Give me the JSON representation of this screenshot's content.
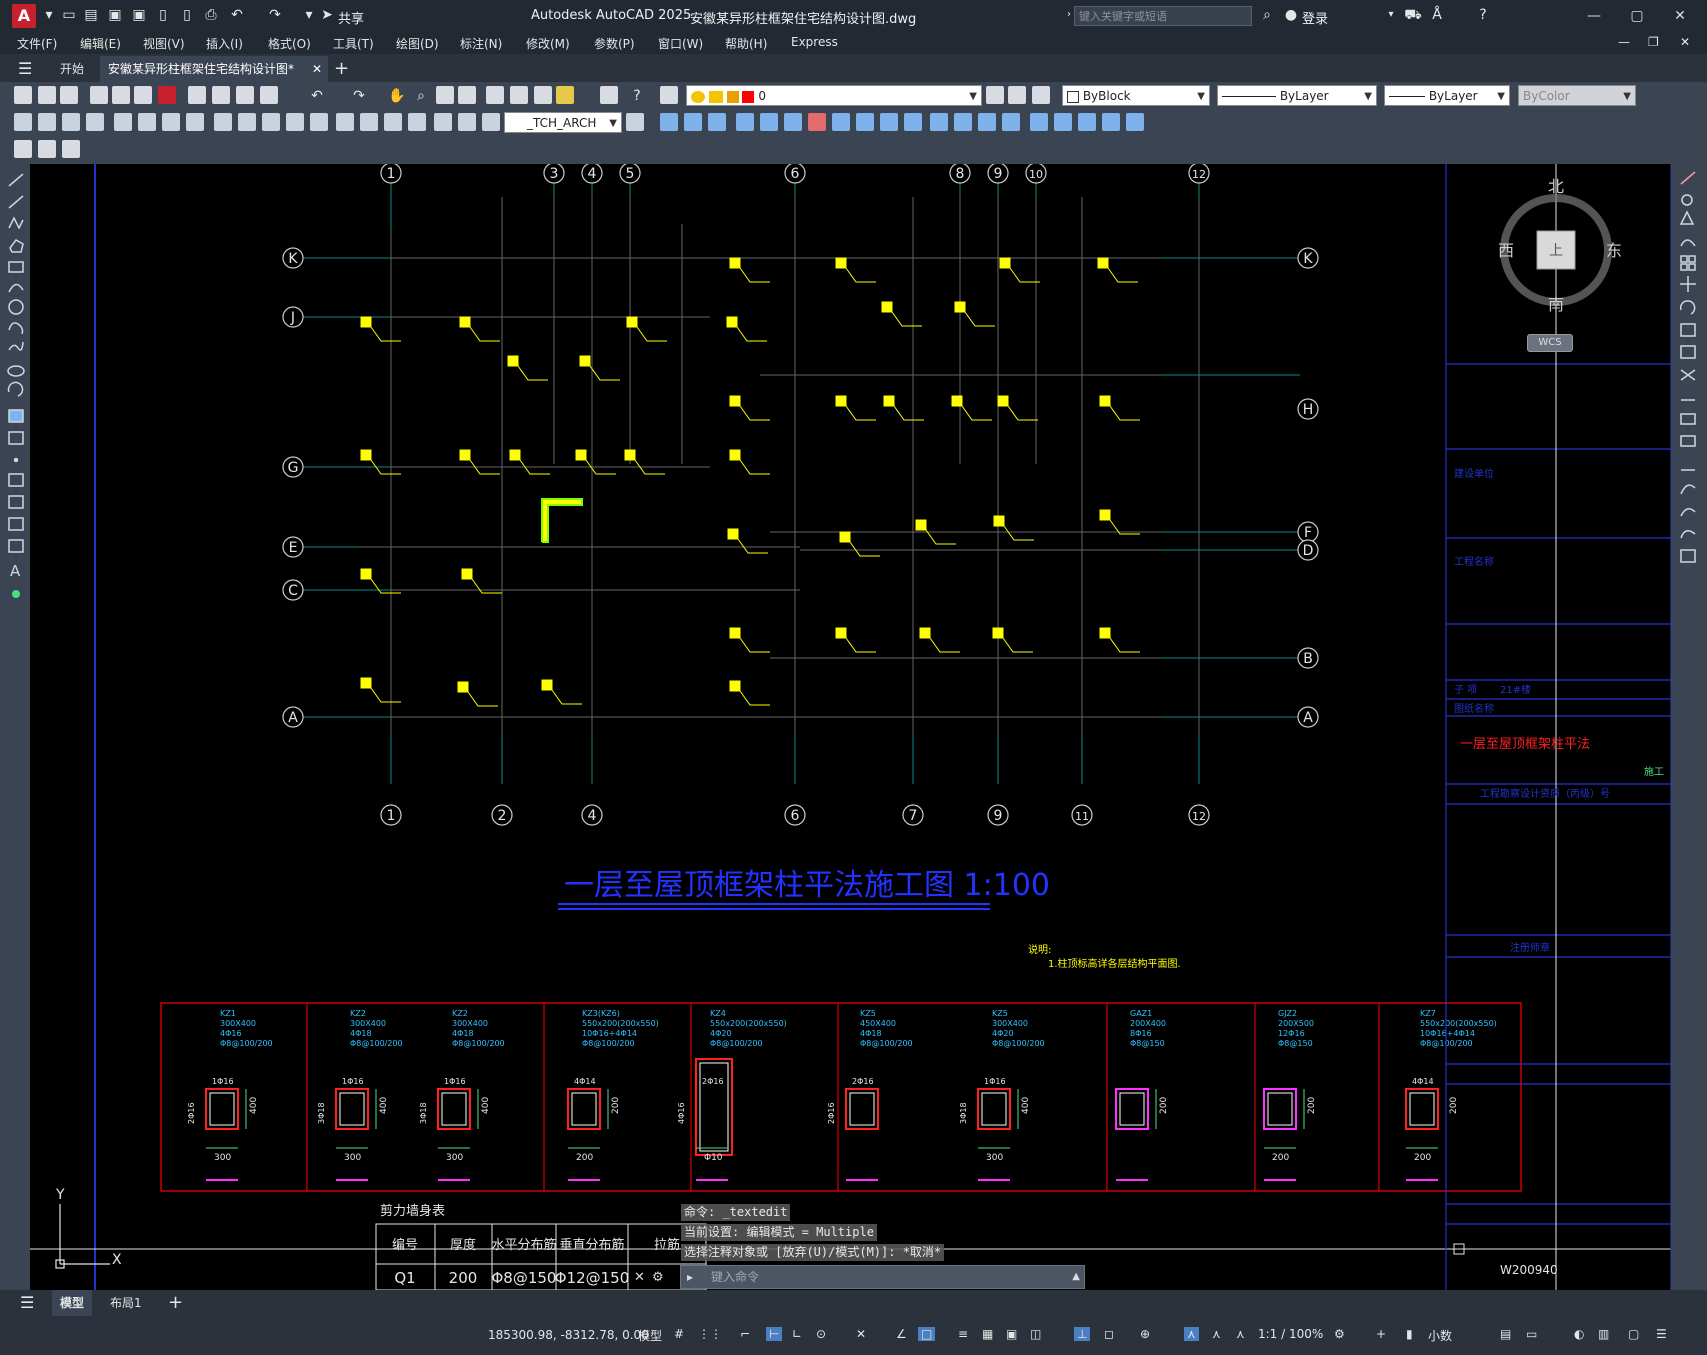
{
  "window": {
    "title": "Autodesk AutoCAD 2025",
    "filename": "安徽某异形柱框架住宅结构设计图.dwg",
    "share_label": "共享",
    "search_placeholder": "键入关键字或短语",
    "login_label": "登录"
  },
  "menu": [
    "文件(F)",
    "编辑(E)",
    "视图(V)",
    "插入(I)",
    "格式(O)",
    "工具(T)",
    "绘图(D)",
    "标注(N)",
    "修改(M)",
    "参数(P)",
    "窗口(W)",
    "帮助(H)",
    "Express"
  ],
  "tabs": {
    "start": "开始",
    "document": "安徽某异形柱框架住宅结构设计图*"
  },
  "properties": {
    "layer": "0",
    "color": "ByBlock",
    "linetype": "ByLayer",
    "lineweight": "ByLayer",
    "plotstyle": "ByColor",
    "textstyle": "_TCH_ARCH"
  },
  "viewcube": {
    "north": "北",
    "south": "南",
    "east": "东",
    "west": "西",
    "top": "上",
    "wcs": "WCS"
  },
  "drawing": {
    "title": "一层至屋顶框架柱平法施工图 1:100",
    "axes_top": [
      "1",
      "3",
      "4",
      "5",
      "6",
      "8",
      "9",
      "10",
      "12"
    ],
    "axes_bottom": [
      "1",
      "2",
      "4",
      "6",
      "7",
      "9",
      "11",
      "12"
    ],
    "axes_left": [
      "K",
      "J",
      "G",
      "E",
      "C",
      "A"
    ],
    "axes_right": [
      "K",
      "H",
      "F",
      "D",
      "B",
      "A"
    ],
    "note_title": "说明:",
    "note_text": "1.柱顶标高详各层结构平面图.",
    "table_title": "剪力墙身表",
    "table_headers": [
      "编号",
      "厚度",
      "水平分布筋",
      "垂直分布筋",
      "拉筋"
    ],
    "table_row": [
      "Q1",
      "200",
      "Φ8@150",
      "Φ12@150",
      ""
    ],
    "sections": [
      {
        "name": "KZ1",
        "lines": [
          "300X400",
          "4Φ16",
          "Φ8@100/200"
        ],
        "top": "1Φ16",
        "side": "2Φ16",
        "dim": "300",
        "h": "400"
      },
      {
        "name": "KZ2",
        "lines": [
          "300X400",
          "4Φ18",
          "Φ8@100/200"
        ],
        "top": "1Φ16",
        "side": "3Φ18",
        "dim": "300",
        "h": "400"
      },
      {
        "name": "KZ2",
        "lines": [
          "300X400",
          "4Φ18",
          "Φ8@100/200"
        ],
        "top": "1Φ16",
        "side": "3Φ18",
        "dim": "300",
        "h": "400"
      },
      {
        "name": "KZ3(KZ6)",
        "lines": [
          "550x200(200x550)",
          "10Φ16+4Φ14",
          "Φ8@100/200"
        ],
        "top": "4Φ14",
        "side": "",
        "dim": "200",
        "h": "200"
      },
      {
        "name": "KZ4",
        "lines": [
          "550x200(200x550)",
          "4Φ20",
          "Φ8@100/200"
        ],
        "top": "2Φ16",
        "side": "4Φ16",
        "dim": "Φ10",
        "h": ""
      },
      {
        "name": "KZ5",
        "lines": [
          "450X400",
          "4Φ18",
          "Φ8@100/200"
        ],
        "top": "2Φ16",
        "side": "2Φ16",
        "dim": "",
        "h": ""
      },
      {
        "name": "KZ5",
        "lines": [
          "300X400",
          "4Φ20",
          "Φ8@100/200"
        ],
        "top": "1Φ16",
        "side": "3Φ18",
        "dim": "300",
        "h": "400"
      },
      {
        "name": "GAZ1",
        "lines": [
          "200X400",
          "8Φ16",
          "Φ8@150"
        ],
        "top": "",
        "side": "",
        "dim": "",
        "h": "200"
      },
      {
        "name": "GJZ2",
        "lines": [
          "200X500",
          "12Φ16",
          "Φ8@150"
        ],
        "top": "",
        "side": "",
        "dim": "200",
        "h": "200"
      },
      {
        "name": "KZ7",
        "lines": [
          "550x200(200x550)",
          "10Φ16+4Φ14",
          "Φ8@100/200"
        ],
        "top": "4Φ14",
        "side": "",
        "dim": "200",
        "h": "200"
      }
    ],
    "titleblock": {
      "label1": "建设单位",
      "label2": "工程名称",
      "label3": "子 项",
      "value3": "21#楼",
      "label4": "图纸名称",
      "drawing_name": "一层至屋顶框架柱平法",
      "stage": "施工",
      "cert": "工程勘察设计资质（丙级）号",
      "note": "注册师章",
      "drawing_no": "W200940"
    }
  },
  "command": {
    "lines": [
      "命令: _textedit",
      "当前设置: 编辑模式 = Multiple",
      "选择注释对象或 [放弃(U)/模式(M)]: *取消*"
    ],
    "input_placeholder": "键入命令"
  },
  "layout_tabs": [
    "模型",
    "布局1"
  ],
  "status": {
    "coords": "185300.98, -8312.78, 0.00",
    "model": "模型",
    "scale": "1:1 / 100%",
    "units": "小数"
  }
}
